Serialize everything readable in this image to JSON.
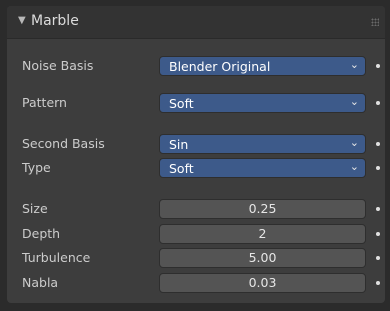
{
  "panel": {
    "title": "Marble"
  },
  "fields": {
    "noise_basis": {
      "label": "Noise Basis",
      "value": "Blender Original"
    },
    "pattern": {
      "label": "Pattern",
      "value": "Soft"
    },
    "second_basis": {
      "label": "Second Basis",
      "value": "Sin"
    },
    "type": {
      "label": "Type",
      "value": "Soft"
    },
    "size": {
      "label": "Size",
      "value": "0.25"
    },
    "depth": {
      "label": "Depth",
      "value": "2"
    },
    "turbulence": {
      "label": "Turbulence",
      "value": "5.00"
    },
    "nabla": {
      "label": "Nabla",
      "value": "0.03"
    }
  },
  "icons": {
    "dropdown": "chevron-down-icon",
    "keyframe": "keyframe-dot-icon",
    "collapse": "triangle-down-icon",
    "grip": "drag-grip-icon"
  }
}
